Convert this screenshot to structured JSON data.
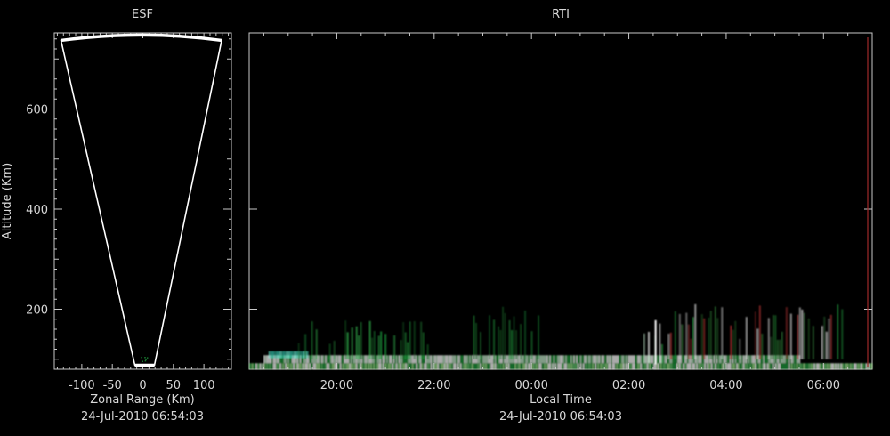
{
  "colors": {
    "background": "#000000",
    "axis": "#c8c8c8",
    "text": "#d8d8d8",
    "fan_outline": "#ffffff",
    "echo_green": "#1e9a3c",
    "echo_cyan": "#37c8b0",
    "echo_white": "#ffffff",
    "echo_red": "#b03030"
  },
  "chart_data": [
    {
      "type": "scatter",
      "title": "ESF",
      "xlabel": "Zonal Range (Km)",
      "ylabel": "Altitude (Km)",
      "timestamp": "24-Jul-2010 06:54:03",
      "xlim": [
        -145,
        145
      ],
      "ylim": [
        80,
        752
      ],
      "xticks": [
        -100,
        -50,
        0,
        50,
        100
      ],
      "xtick_labels": [
        "-100",
        "-50",
        "0",
        "50",
        "100"
      ],
      "yticks": [
        200,
        400,
        600
      ],
      "ytick_labels": [
        "200",
        "400",
        "600"
      ],
      "grid": false,
      "fan": {
        "outline": [
          [
            -13,
            88
          ],
          [
            -134,
            737
          ],
          [
            -61,
            746
          ],
          [
            0,
            748
          ],
          [
            61,
            746
          ],
          [
            129,
            737
          ],
          [
            19,
            88
          ]
        ],
        "bottom_arc": {
          "x": [
            -13,
            19
          ],
          "y": 88
        },
        "top_arc": {
          "x": [
            -134,
            129
          ],
          "y": 744
        }
      }
    },
    {
      "type": "heatmap",
      "title": "RTI",
      "xlabel": "Local Time",
      "ylabel": "",
      "timestamp": "24-Jul-2010 06:54:03",
      "xlim": [
        18.2,
        31.0
      ],
      "ylim": [
        80,
        752
      ],
      "xticks": [
        20,
        22,
        24,
        26,
        28,
        30
      ],
      "xtick_labels": [
        "20:00",
        "22:00",
        "00:00",
        "02:00",
        "04:00",
        "06:00"
      ],
      "yticks": [
        200,
        400,
        600
      ],
      "grid": false,
      "layers": [
        {
          "name": "base_layer",
          "t_start": 18.2,
          "t_end": 31.0,
          "alt_low": 80,
          "alt_high": 92,
          "color": "green-white"
        },
        {
          "name": "bottomside_echo",
          "t_start": 18.5,
          "t_end": 29.5,
          "alt_low": 92,
          "alt_high": 108,
          "color": "white"
        },
        {
          "name": "cyan_patch",
          "t_start": 18.6,
          "t_end": 19.4,
          "alt_low": 102,
          "alt_high": 116,
          "color": "cyan"
        },
        {
          "name": "plume_early",
          "t_start": 19.2,
          "t_end": 21.9,
          "alt_low": 100,
          "alt_high": 178,
          "color": "green"
        },
        {
          "name": "plume_midnight",
          "t_start": 22.8,
          "t_end": 24.2,
          "alt_low": 100,
          "alt_high": 205,
          "color": "green"
        },
        {
          "name": "plume_2am",
          "t_start": 26.3,
          "t_end": 26.7,
          "alt_low": 92,
          "alt_high": 180,
          "color": "white"
        },
        {
          "name": "plume_late",
          "t_start": 26.8,
          "t_end": 30.5,
          "alt_low": 100,
          "alt_high": 210,
          "color": "green-red"
        }
      ]
    }
  ]
}
